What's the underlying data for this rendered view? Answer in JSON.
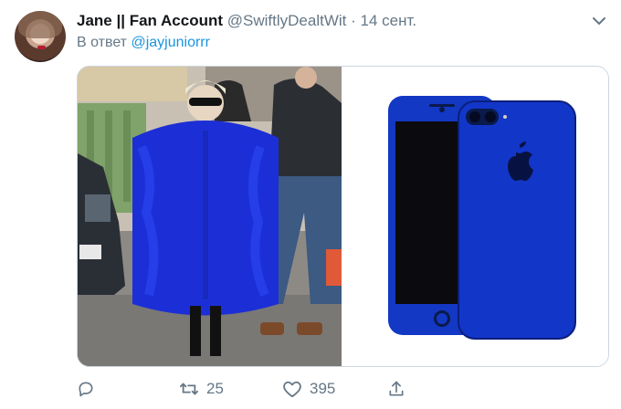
{
  "tweet": {
    "display_name": "Jane || Fan Account",
    "handle": "@SwiftlyDealtWit",
    "dot": "·",
    "time": "14 сент.",
    "reply_prefix": "В ответ",
    "reply_to": "@jayjuniorrr",
    "caret_icon": "chevron-down-icon"
  },
  "media": {
    "left_image": "photo-blue-fur-coat",
    "right_image": "iphone-blue-render",
    "accent": "#1133cc"
  },
  "actions": {
    "reply_icon": "reply-icon",
    "retweet_icon": "retweet-icon",
    "retweet_count": "25",
    "like_icon": "heart-icon",
    "like_count": "395",
    "share_icon": "share-icon"
  },
  "colors": {
    "text_primary": "#14171a",
    "text_secondary": "#657786",
    "link": "#1b95e0",
    "border": "#ccd6dd"
  }
}
